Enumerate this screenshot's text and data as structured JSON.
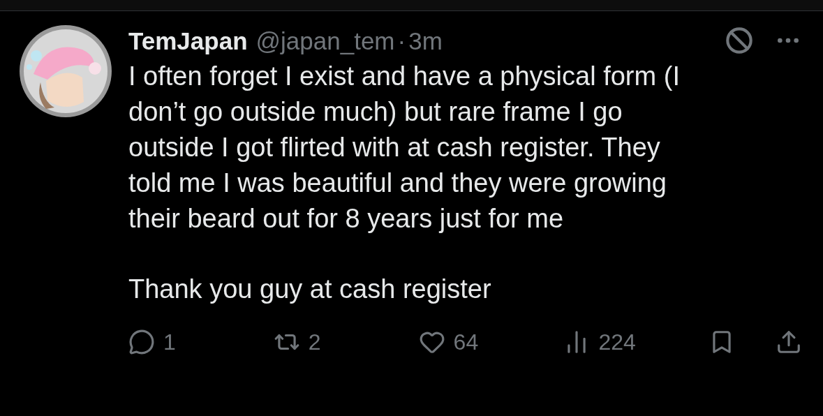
{
  "tweet": {
    "display_name": "TemJapan",
    "handle": "@japan_tem",
    "separator": "·",
    "time": "3m",
    "paragraphs": [
      "I often forget I exist and have a physical form (I don’t go outside much) but rare frame I go outside I got flirted with at cash register. They told me I was beautiful and they were growing their beard out for 8 years just for me",
      "Thank you guy at cash register"
    ],
    "actions": [
      {
        "kind": "reply",
        "count": "1"
      },
      {
        "kind": "retweet",
        "count": "2"
      },
      {
        "kind": "like",
        "count": "64"
      },
      {
        "kind": "views",
        "count": "224"
      },
      {
        "kind": "bookmark"
      },
      {
        "kind": "share"
      }
    ]
  }
}
